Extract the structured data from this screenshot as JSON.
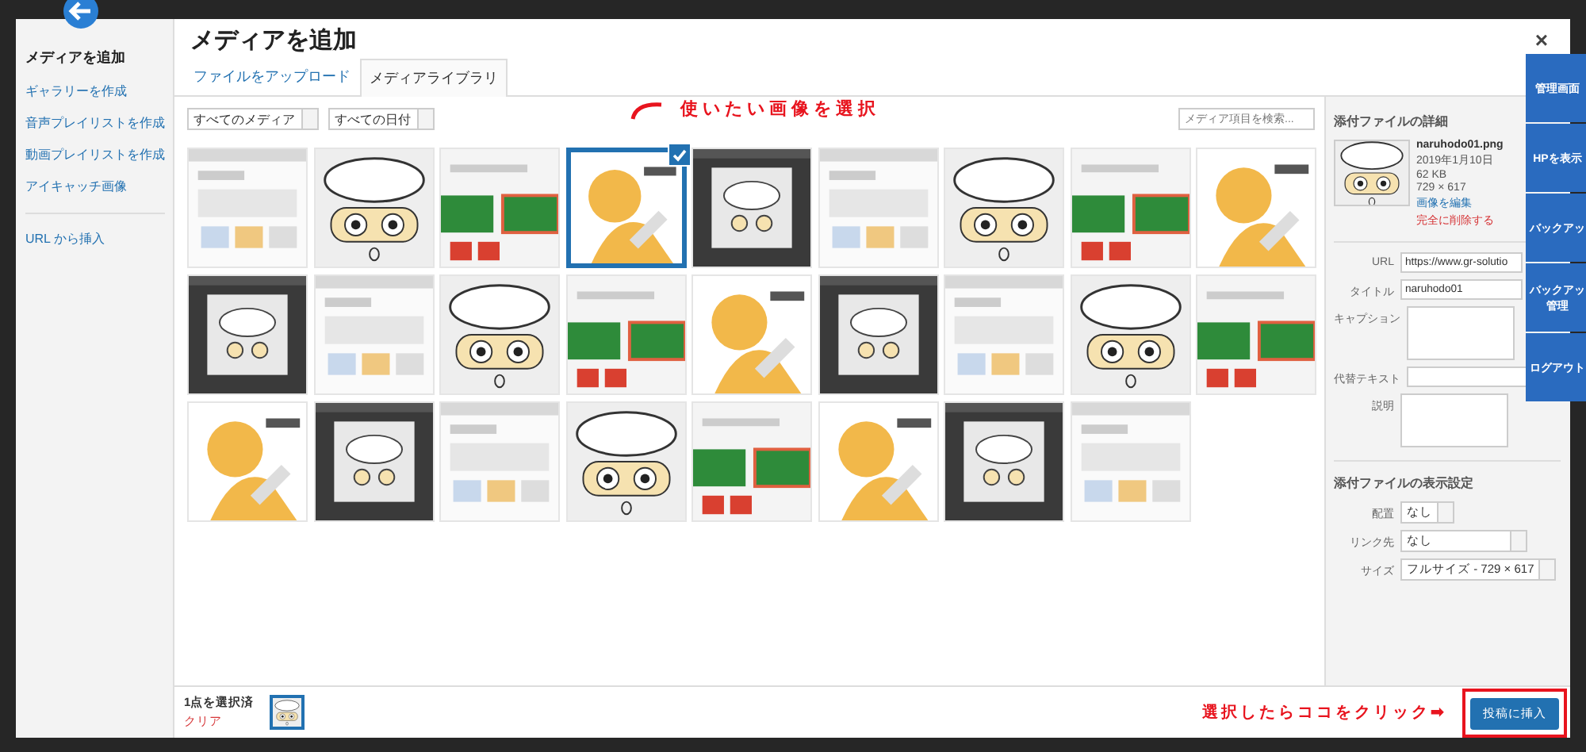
{
  "sidebar": {
    "title": "メディアを追加",
    "items": [
      {
        "label": "ギャラリーを作成"
      },
      {
        "label": "音声プレイリストを作成"
      },
      {
        "label": "動画プレイリストを作成"
      },
      {
        "label": "アイキャッチ画像"
      }
    ],
    "extra_item": {
      "label": "URL から挿入"
    }
  },
  "header": {
    "title": "メディアを追加",
    "close": "×"
  },
  "tabs": [
    {
      "label": "ファイルをアップロード",
      "selected": false
    },
    {
      "label": "メディアライブラリ",
      "selected": true
    }
  ],
  "filters": [
    {
      "value": "すべてのメディア"
    },
    {
      "value": "すべての日付"
    }
  ],
  "search": {
    "placeholder": "メディア項目を検索..."
  },
  "annotation_top": "使いたい画像を選択",
  "library": {
    "items": [
      {
        "kind": "picture",
        "selected": false
      },
      {
        "kind": "picture",
        "selected": false
      },
      {
        "kind": "picture",
        "selected": false
      },
      {
        "kind": "picture",
        "selected": true
      },
      {
        "kind": "picture",
        "selected": false
      },
      {
        "kind": "picture",
        "selected": false
      },
      {
        "kind": "picture",
        "selected": false
      },
      {
        "kind": "picture",
        "selected": false
      },
      {
        "kind": "picture",
        "selected": false
      },
      {
        "kind": "picture",
        "selected": false
      },
      {
        "kind": "picture",
        "selected": false
      },
      {
        "kind": "picture",
        "selected": false
      },
      {
        "kind": "picture",
        "selected": false
      },
      {
        "kind": "picture",
        "selected": false
      },
      {
        "kind": "picture",
        "selected": false
      },
      {
        "kind": "picture",
        "selected": false
      },
      {
        "kind": "picture",
        "selected": false
      },
      {
        "kind": "picture",
        "selected": false
      },
      {
        "kind": "picture",
        "selected": false
      },
      {
        "kind": "picture",
        "selected": false
      },
      {
        "kind": "picture",
        "selected": false
      },
      {
        "kind": "picture",
        "selected": false
      },
      {
        "kind": "picture",
        "selected": false
      },
      {
        "kind": "picture",
        "selected": false
      },
      {
        "kind": "picture",
        "selected": false
      },
      {
        "kind": "picture",
        "selected": false
      }
    ]
  },
  "details": {
    "title": "添付ファイルの詳細",
    "filename": "naruhodo01.png",
    "date": "2019年1月10日",
    "size": "62 KB",
    "dimensions": "729 × 617",
    "edit_link": "画像を編集",
    "delete_link": "完全に削除する",
    "fields": [
      {
        "label": "URL",
        "value": "https://www.gr-solutio",
        "kind": "input"
      },
      {
        "label": "タイトル",
        "value": "naruhodo01",
        "kind": "input"
      },
      {
        "label": "キャプション",
        "kind": "textarea"
      },
      {
        "label": "代替テキスト",
        "kind": "input"
      },
      {
        "label": "説明",
        "kind": "textarea"
      }
    ]
  },
  "display_settings": {
    "title": "添付ファイルの表示設定",
    "fields": [
      {
        "label": "配置",
        "value": "なし"
      },
      {
        "label": "リンク先",
        "value": "なし"
      },
      {
        "label": "サイズ",
        "value": "フルサイズ - 729 × 617"
      }
    ]
  },
  "footer": {
    "selected_count": "1点を選択済",
    "clear": "クリア",
    "annotation": "選択したらココをクリック➡",
    "insert_button": "投稿に挿入"
  },
  "side_menu": [
    {
      "lines": [
        "管理画面"
      ]
    },
    {
      "lines": [
        "HPを表示"
      ]
    },
    {
      "lines": [
        "バックアッ"
      ]
    },
    {
      "lines": [
        "バックアッ",
        "管理"
      ]
    },
    {
      "lines": [
        "ログアウト"
      ]
    }
  ]
}
